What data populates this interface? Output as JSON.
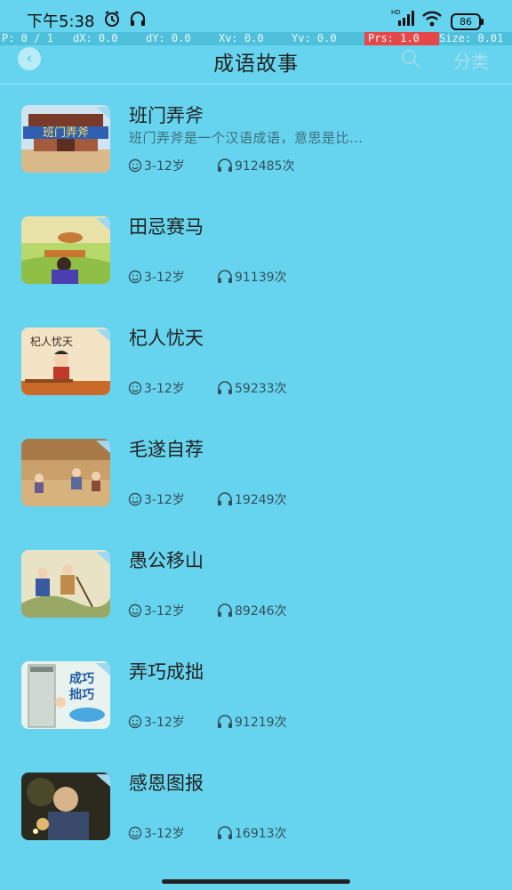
{
  "status": {
    "time": "下午5:38",
    "battery": "86",
    "network": "HD"
  },
  "debug": {
    "pointers": "P: 0 / 1",
    "dx": "dX: 0.0",
    "dy": "dY: 0.0",
    "xv": "Xv: 0.0",
    "yv": "Yv: 0.0",
    "prs": "Prs: 1.0",
    "size": "Size: 0.01"
  },
  "header": {
    "title": "成语故事",
    "category": "分类",
    "back_icon": "back-chevron-icon",
    "search_icon": "search-icon"
  },
  "stories": [
    {
      "title": "班门弄斧",
      "desc": "班门弄斧是一个汉语成语，意思是比…",
      "age": "3-12岁",
      "plays": "912485次"
    },
    {
      "title": "田忌赛马",
      "desc": "",
      "age": "3-12岁",
      "plays": "91139次"
    },
    {
      "title": "杞人忧天",
      "desc": "",
      "age": "3-12岁",
      "plays": "59233次"
    },
    {
      "title": "毛遂自荐",
      "desc": "",
      "age": "3-12岁",
      "plays": "19249次"
    },
    {
      "title": "愚公移山",
      "desc": "",
      "age": "3-12岁",
      "plays": "89246次"
    },
    {
      "title": "弄巧成拙",
      "desc": "",
      "age": "3-12岁",
      "plays": "91219次"
    },
    {
      "title": "感恩图报",
      "desc": "",
      "age": "3-12岁",
      "plays": "16913次"
    }
  ],
  "thumb_text": {
    "s0": "班门弄斧",
    "s2": "杞人忧天",
    "s5a": "成巧",
    "s5b": "拙巧"
  },
  "colors": {
    "background": "#66d4ee",
    "debug_bar": "#4fc0dc",
    "pressure": "#e8474a"
  }
}
